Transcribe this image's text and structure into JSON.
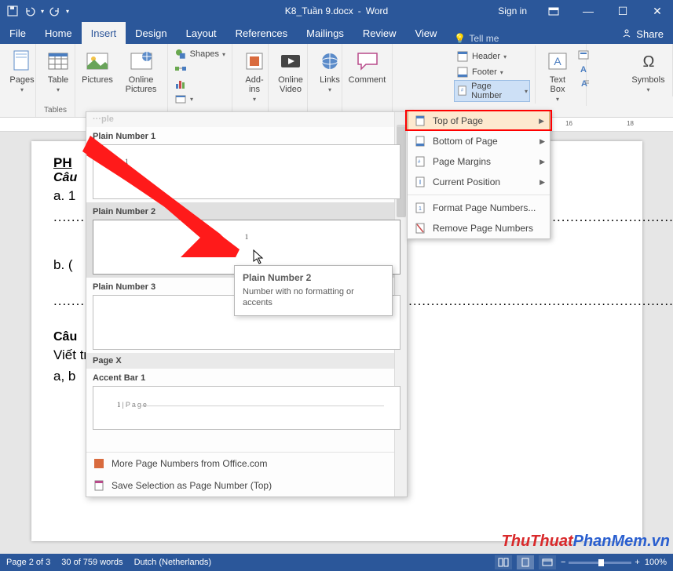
{
  "titlebar": {
    "doc_name": "K8_Tuần 9.docx",
    "app_name": "Word",
    "sign_in": "Sign in"
  },
  "tabs": {
    "file": "File",
    "home": "Home",
    "insert": "Insert",
    "design": "Design",
    "layout": "Layout",
    "references": "References",
    "mailings": "Mailings",
    "review": "Review",
    "view": "View",
    "tellme": "Tell me",
    "share": "Share"
  },
  "ribbon": {
    "pages": "Pages",
    "table": "Table",
    "tables_group": "Tables",
    "pictures": "Pictures",
    "online_pictures": "Online Pictures",
    "shapes": "Shapes",
    "addins": "Add-ins",
    "online_video": "Online Video",
    "links": "Links",
    "comment": "Comment",
    "header": "Header",
    "footer": "Footer",
    "page_number": "Page Number",
    "text_box": "Text Box",
    "symbols": "Symbols"
  },
  "pn_menu": {
    "top": "Top of Page",
    "bottom": "Bottom of Page",
    "margins": "Page Margins",
    "current": "Current Position",
    "format": "Format Page Numbers...",
    "remove": "Remove Page Numbers"
  },
  "gallery": {
    "cat_simple": "Simple",
    "item1": "Plain Number 1",
    "item2": "Plain Number 2",
    "item3": "Plain Number 3",
    "cat_pagex": "Page X",
    "item4": "Accent Bar 1",
    "accent_text": "Page",
    "more": "More Page Numbers from Office.com",
    "save_sel": "Save Selection as Page Number (Top)"
  },
  "tooltip": {
    "title": "Plain Number 2",
    "body": "Number with no formatting or accents"
  },
  "document": {
    "ph": "PH",
    "cau": "Câu",
    "a1": "a. 1",
    "b": "b. (",
    "cau2": "Câu",
    "body_line": "Viết                                                                                    trung bình cộng của hai số",
    "ab": "a, b"
  },
  "ruler": {
    "m16": "16",
    "m18": "18"
  },
  "status": {
    "page": "Page 2 of 3",
    "words": "30 of 759 words",
    "lang": "Dutch (Netherlands)",
    "zoom": "100%"
  },
  "watermark": {
    "part1": "ThuThuat",
    "part2": "PhanMem",
    "part3": ".vn"
  }
}
